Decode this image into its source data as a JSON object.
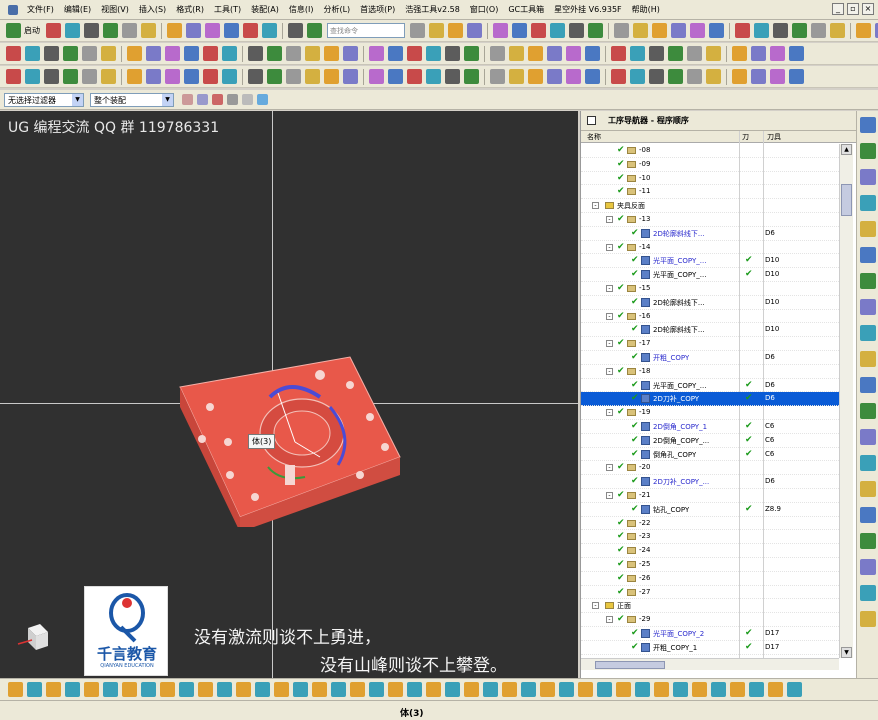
{
  "menubar": {
    "items": [
      "文件(F)",
      "编辑(E)",
      "视图(V)",
      "插入(S)",
      "格式(R)",
      "工具(T)",
      "装配(A)",
      "信息(I)",
      "分析(L)",
      "首选项(P)",
      "浩强工具v2.58",
      "窗口(O)",
      "GC工具箱",
      "星空外挂 V6.935F",
      "帮助(H)"
    ]
  },
  "toolbar": {
    "start_label": "启动",
    "command_search_placeholder": "查找命令"
  },
  "filterbar": {
    "type_filter": "无选择过滤器",
    "scope_filter": "整个装配"
  },
  "viewport": {
    "title": "UG 编程交流 QQ 群 119786331",
    "tooltip": "体(3)",
    "logo_text": "千言教育",
    "logo_sub": "QIANYAN EDUCATION",
    "slogan_line1": "没有激流则谈不上勇进，",
    "slogan_line2": "没有山峰则谈不上攀登。"
  },
  "navigator": {
    "title": "工序导航器 - 程序顺序",
    "columns": {
      "name": "名称",
      "path": "刀",
      "tool": "刀具"
    },
    "rows": [
      {
        "level": 2,
        "kind": "group",
        "label": "-08",
        "check": true
      },
      {
        "level": 2,
        "kind": "group",
        "label": "-09",
        "check": true
      },
      {
        "level": 2,
        "kind": "group",
        "label": "-10",
        "check": true
      },
      {
        "level": 2,
        "kind": "group",
        "label": "-11",
        "check": true
      },
      {
        "level": 1,
        "kind": "folder",
        "label": "夹具反面",
        "expand": "-"
      },
      {
        "level": 2,
        "kind": "group",
        "label": "-13",
        "check": true,
        "expand": "-"
      },
      {
        "level": 3,
        "kind": "op",
        "label": "2D轮廓斜线下...",
        "check": true,
        "blue": true,
        "tool": "D6"
      },
      {
        "level": 2,
        "kind": "group",
        "label": "-14",
        "check": true,
        "expand": "-"
      },
      {
        "level": 3,
        "kind": "op",
        "label": "光平面_COPY_...",
        "check": true,
        "blue": true,
        "path": true,
        "tool": "D10"
      },
      {
        "level": 3,
        "kind": "op",
        "label": "光平面_COPY_...",
        "check": true,
        "path": true,
        "tool": "D10"
      },
      {
        "level": 2,
        "kind": "group",
        "label": "-15",
        "check": true,
        "expand": "-"
      },
      {
        "level": 3,
        "kind": "op",
        "label": "2D轮廓斜线下...",
        "check": true,
        "tool": "D10"
      },
      {
        "level": 2,
        "kind": "group",
        "label": "-16",
        "check": true,
        "expand": "-"
      },
      {
        "level": 3,
        "kind": "op",
        "label": "2D轮廓斜线下...",
        "check": true,
        "tool": "D10"
      },
      {
        "level": 2,
        "kind": "group",
        "label": "-17",
        "check": true,
        "expand": "-"
      },
      {
        "level": 3,
        "kind": "op",
        "label": "开粗_COPY",
        "check": true,
        "blue": true,
        "tool": "D6"
      },
      {
        "level": 2,
        "kind": "group",
        "label": "-18",
        "check": true,
        "expand": "-"
      },
      {
        "level": 3,
        "kind": "op",
        "label": "光平面_COPY_...",
        "check": true,
        "path": true,
        "tool": "D6"
      },
      {
        "level": 3,
        "kind": "op",
        "label": "2D刀补_COPY",
        "check": true,
        "path": true,
        "tool": "D6",
        "selected": true
      },
      {
        "level": 2,
        "kind": "group",
        "label": "-19",
        "check": true,
        "expand": "-"
      },
      {
        "level": 3,
        "kind": "op",
        "label": "2D倒角_COPY_1",
        "check": true,
        "blue": true,
        "path": true,
        "tool": "C6"
      },
      {
        "level": 3,
        "kind": "op",
        "label": "2D倒角_COPY_...",
        "check": true,
        "path": true,
        "tool": "C6"
      },
      {
        "level": 3,
        "kind": "op",
        "label": "倒角孔_COPY",
        "check": true,
        "path": true,
        "tool": "C6"
      },
      {
        "level": 2,
        "kind": "group",
        "label": "-20",
        "check": true,
        "expand": "-"
      },
      {
        "level": 3,
        "kind": "op",
        "label": "2D刀补_COPY_...",
        "check": true,
        "blue": true,
        "tool": "D6"
      },
      {
        "level": 2,
        "kind": "group",
        "label": "-21",
        "check": true,
        "expand": "-"
      },
      {
        "level": 3,
        "kind": "op",
        "label": "钻孔_COPY",
        "check": true,
        "path": true,
        "tool": "Z8.9"
      },
      {
        "level": 2,
        "kind": "group",
        "label": "-22",
        "check": true
      },
      {
        "level": 2,
        "kind": "group",
        "label": "-23",
        "check": true
      },
      {
        "level": 2,
        "kind": "group",
        "label": "-24",
        "check": true
      },
      {
        "level": 2,
        "kind": "group",
        "label": "-25",
        "check": true
      },
      {
        "level": 2,
        "kind": "group",
        "label": "-26",
        "check": true
      },
      {
        "level": 2,
        "kind": "group",
        "label": "-27",
        "check": true
      },
      {
        "level": 1,
        "kind": "folder",
        "label": "正面",
        "expand": "-"
      },
      {
        "level": 2,
        "kind": "group",
        "label": "-29",
        "check": true,
        "expand": "-"
      },
      {
        "level": 3,
        "kind": "op",
        "label": "光平面_COPY_2",
        "check": true,
        "blue": true,
        "path": true,
        "tool": "D17"
      },
      {
        "level": 3,
        "kind": "op",
        "label": "开粗_COPY_1",
        "check": true,
        "path": true,
        "tool": "D17"
      }
    ]
  },
  "status": {
    "text": "体(3)"
  },
  "colors": {
    "model": "#e8584a",
    "viewport_bg": "#303030",
    "selection": "#0a5bd6",
    "check": "#1a9a1a"
  }
}
